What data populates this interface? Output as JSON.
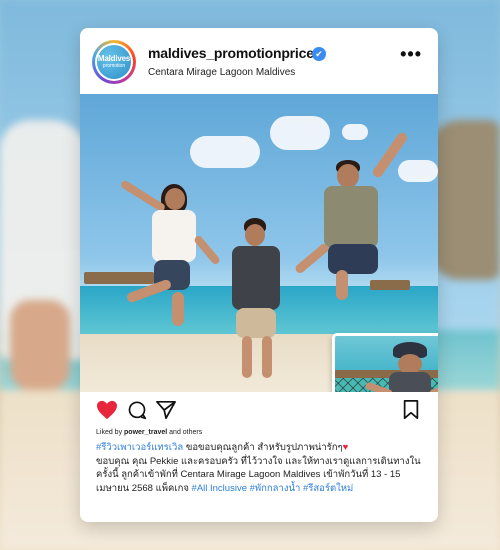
{
  "post": {
    "avatar": {
      "title": "Maldives",
      "subtitle": "promotion"
    },
    "username": "maldives_promotionprice",
    "verified_icon": "✔",
    "location": "Centara Mirage Lagoon Maldives",
    "more_icon": "•••",
    "liked_prefix": "Liked by ",
    "liked_user": "power_travel",
    "liked_suffix": " and others",
    "caption": {
      "hashtag_first": "#รีวิวเพาเวอร์แทรเวิล",
      "line1": " ขอขอบคุณลูกค้า สำหรับรูปภาพน่ารักๆ",
      "heart": "♥",
      "line2": "ขอบคุณ คุณ Pekkie และครอบครัว ที่ไว้วางใจ และให้ทางเราดูแลการเดินทางในครั้งนี้ ลูกค้าเข้าพักที่ Centara Mirage Lagoon Maldives เข้าพักวันที่ 13 - 15 เมษายน 2568 แพ็คเกจ ",
      "hashtags_end": [
        "#All Inclusive",
        "#พักกลางน้ำ",
        "#รีสอร์ตใหม่"
      ]
    }
  },
  "colors": {
    "accent": "#2f7fd8",
    "like": "#e8263b",
    "verified": "#3b8cf0"
  },
  "icons": {
    "like": "heart-icon",
    "comment": "comment-icon",
    "share": "share-icon",
    "save": "bookmark-icon"
  }
}
